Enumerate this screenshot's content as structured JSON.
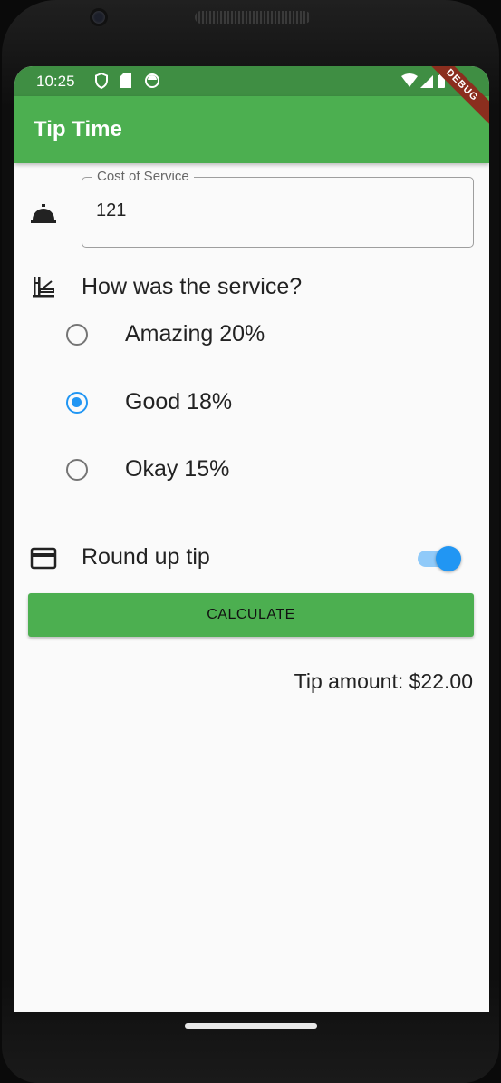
{
  "status_bar": {
    "time": "10:25"
  },
  "app_bar": {
    "title": "Tip Time",
    "debug_banner": "DEBUG"
  },
  "cost_field": {
    "label": "Cost of Service",
    "value": "121"
  },
  "service_question": "How was the service?",
  "tip_options": [
    {
      "label": "Amazing 20%",
      "selected": false
    },
    {
      "label": "Good 18%",
      "selected": true
    },
    {
      "label": "Okay 15%",
      "selected": false
    }
  ],
  "round_up": {
    "label": "Round up tip",
    "enabled": true
  },
  "calculate_button": "CALCULATE",
  "result": "Tip amount: $22.00",
  "colors": {
    "app_bar": "#4caf50",
    "status_bar": "#3f8e43",
    "accent": "#2196f3",
    "button": "#4caf50"
  }
}
